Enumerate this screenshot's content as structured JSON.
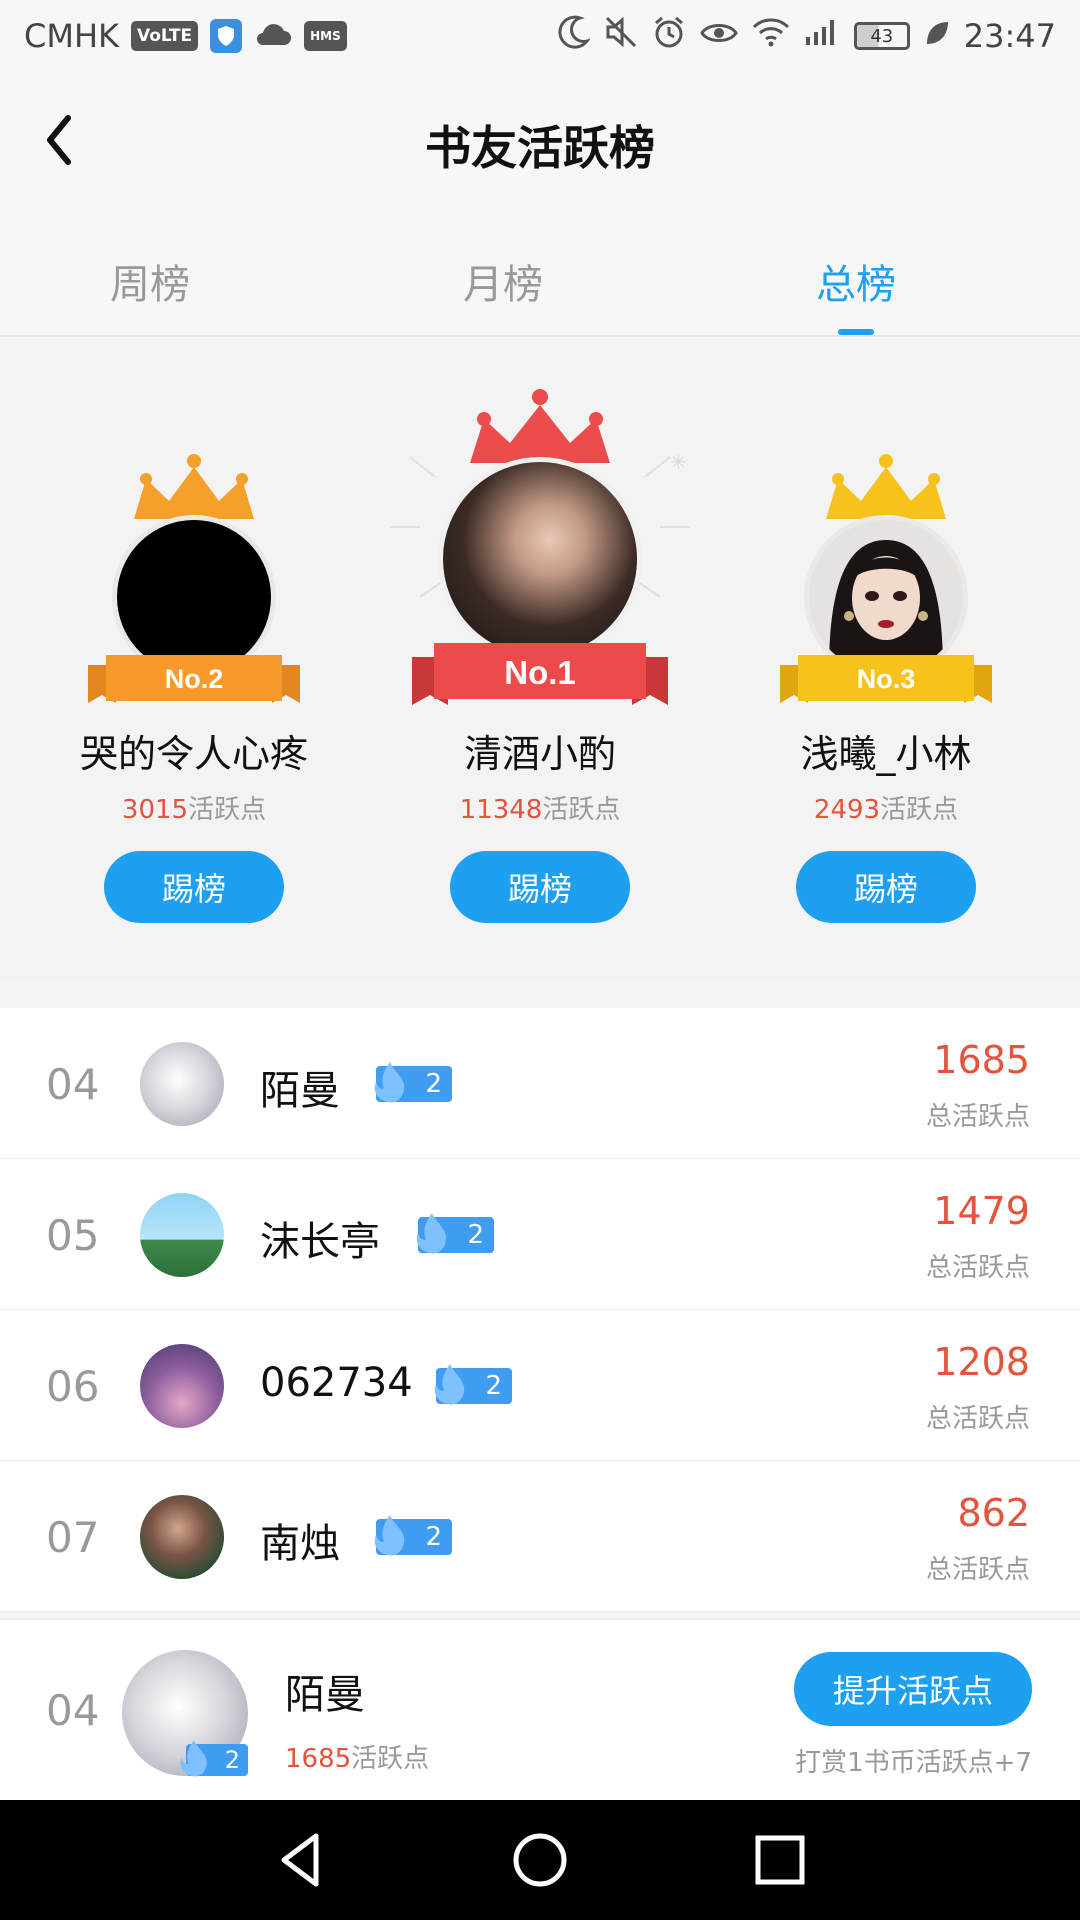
{
  "status_bar": {
    "carrier": "CMHK",
    "volte": "VoLTE",
    "hms": "HMS",
    "battery": "43",
    "time": "23:47"
  },
  "header": {
    "title": "书友活跃榜"
  },
  "tabs": [
    {
      "label": "周榜",
      "active": false
    },
    {
      "label": "月榜",
      "active": false
    },
    {
      "label": "总榜",
      "active": true
    }
  ],
  "podium": [
    {
      "rank_label": "No.2",
      "name": "哭的令人心疼",
      "points": "3015",
      "points_suffix": "活跃点",
      "button": "踢榜",
      "crown_color": "#f5a02a"
    },
    {
      "rank_label": "No.1",
      "name": "清酒小酌",
      "points": "11348",
      "points_suffix": "活跃点",
      "button": "踢榜",
      "crown_color": "#ec4b4b"
    },
    {
      "rank_label": "No.3",
      "name": "浅曦_小林",
      "points": "2493",
      "points_suffix": "活跃点",
      "button": "踢榜",
      "crown_color": "#f7c21c"
    }
  ],
  "list": [
    {
      "rank": "04",
      "name": "陌曼",
      "level": "2",
      "value": "1685",
      "label": "总活跃点"
    },
    {
      "rank": "05",
      "name": "沫长亭",
      "level": "2",
      "value": "1479",
      "label": "总活跃点"
    },
    {
      "rank": "06",
      "name": "062734",
      "level": "2",
      "value": "1208",
      "label": "总活跃点"
    },
    {
      "rank": "07",
      "name": "南烛",
      "level": "2",
      "value": "862",
      "label": "总活跃点"
    }
  ],
  "me": {
    "rank": "04",
    "name": "陌曼",
    "level": "2",
    "points": "1685",
    "points_suffix": "活跃点",
    "button": "提升活跃点",
    "hint": "打赏1书币活跃点+7"
  },
  "colors": {
    "accent": "#1ea0f0",
    "value_red": "#e5533d",
    "badge_blue": "#3f9cf0"
  }
}
